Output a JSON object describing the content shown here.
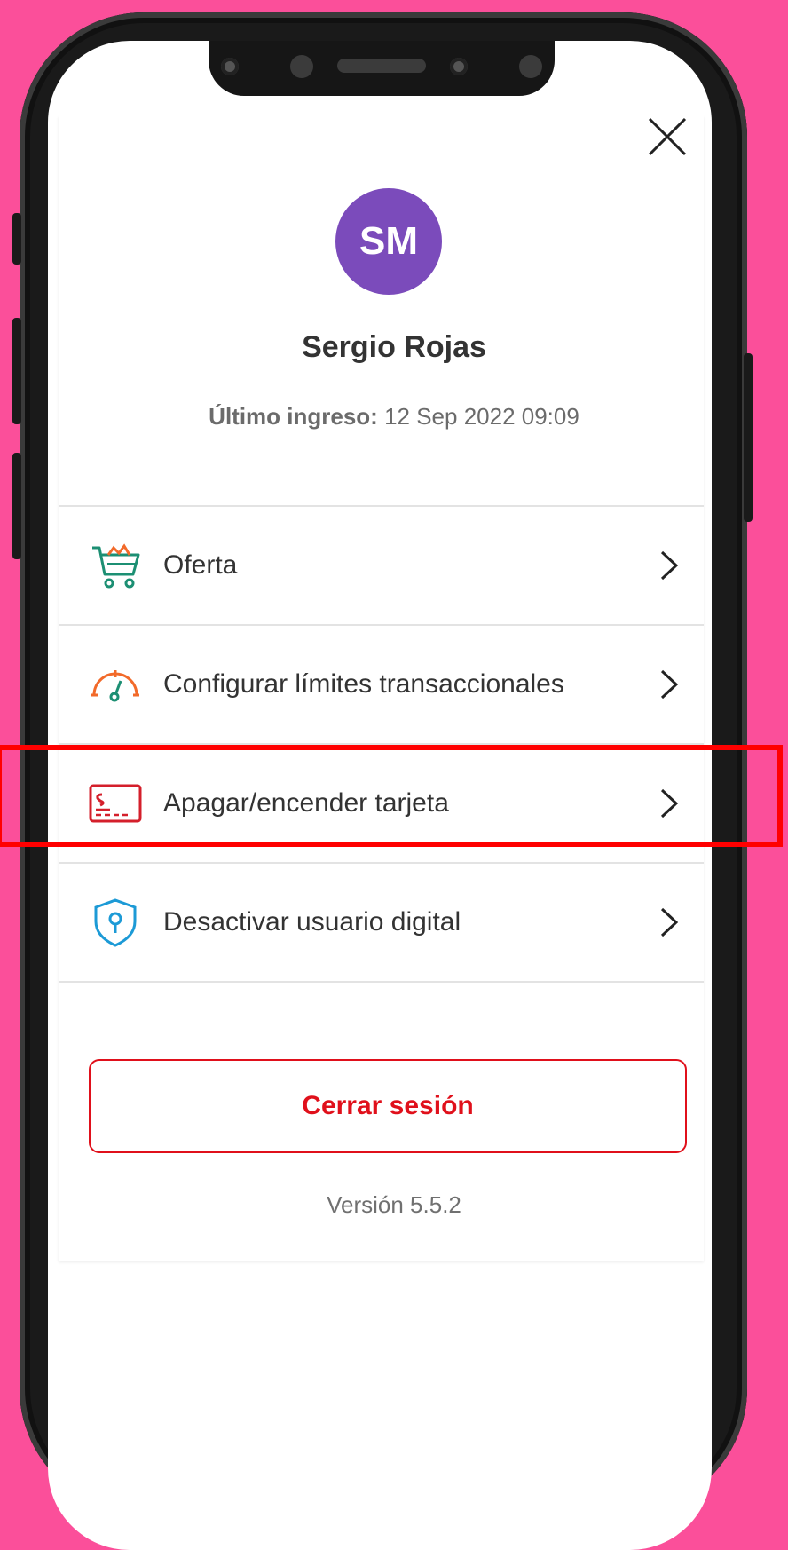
{
  "user": {
    "initials": "SM",
    "name": "Sergio Rojas",
    "last_login_label": "Último ingreso:",
    "last_login_value": " 12 Sep 2022 09:09"
  },
  "menu": {
    "items": [
      {
        "label": "Oferta",
        "icon": "shopping-cart-icon"
      },
      {
        "label": "Configurar límites transaccionales",
        "icon": "speedometer-icon"
      },
      {
        "label": "Apagar/encender tarjeta",
        "icon": "credit-card-icon"
      },
      {
        "label": "Desactivar usuario digital",
        "icon": "shield-lock-icon"
      }
    ]
  },
  "actions": {
    "logout_label": "Cerrar sesión",
    "close_icon": "close-icon"
  },
  "footer": {
    "version": "Versión 5.5.2"
  },
  "colors": {
    "background": "#fb4f9a",
    "accent_red": "#e0101b",
    "avatar": "#7b4bbb",
    "highlight": "#ff0000"
  }
}
